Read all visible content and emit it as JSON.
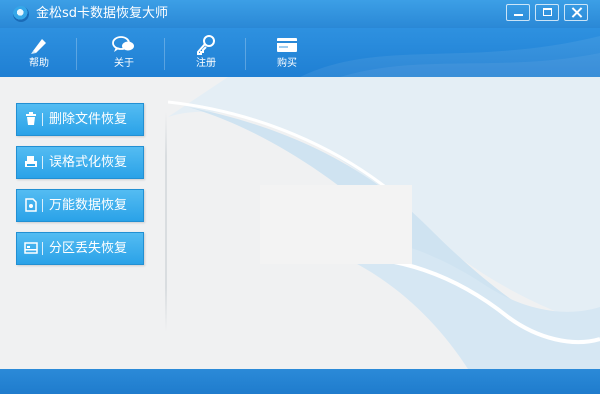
{
  "window": {
    "title": "金松sd卡数据恢复大师",
    "controls": [
      "minimize",
      "maximize",
      "close"
    ]
  },
  "toolbar": {
    "items": [
      {
        "label": "帮助",
        "icon": "pen-icon"
      },
      {
        "label": "关于",
        "icon": "chat-icon"
      },
      {
        "label": "注册",
        "icon": "key-icon"
      },
      {
        "label": "购买",
        "icon": "card-icon"
      }
    ]
  },
  "sidebar": {
    "items": [
      {
        "label": "删除文件恢复",
        "icon": "trash-icon"
      },
      {
        "label": "误格式化恢复",
        "icon": "printer-icon"
      },
      {
        "label": "万能数据恢复",
        "icon": "document-icon"
      },
      {
        "label": "分区丢失恢复",
        "icon": "partition-icon"
      }
    ]
  },
  "colors": {
    "title_bar": "#2a88d6",
    "toolbar": "#1f7fd3",
    "button": "#34a8ec",
    "status_bar": "#1f7ccd",
    "content_bg": "#f0f1f2"
  }
}
